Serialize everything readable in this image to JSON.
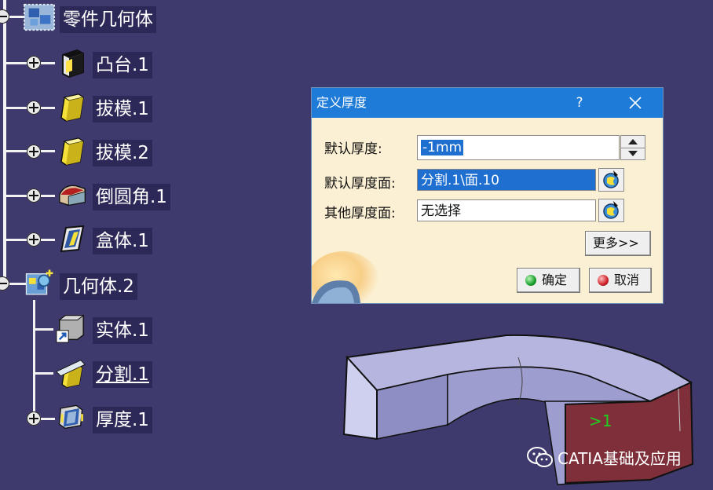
{
  "tree": {
    "root": {
      "label": "零件几何体",
      "icon": "part-body-icon"
    },
    "features": [
      {
        "label": "凸台.1",
        "icon": "pad-icon"
      },
      {
        "label": "拔模.1",
        "icon": "draft-icon"
      },
      {
        "label": "拔模.2",
        "icon": "draft-icon"
      },
      {
        "label": "倒圆角.1",
        "icon": "fillet-icon"
      },
      {
        "label": "盒体.1",
        "icon": "shell-icon"
      }
    ],
    "body2": {
      "label": "几何体.2",
      "icon": "geometric-body-icon",
      "children": [
        {
          "label": "实体.1",
          "icon": "solid-icon"
        },
        {
          "label": "分割.1",
          "icon": "split-icon"
        },
        {
          "label": "厚度.1",
          "icon": "thickness-icon"
        }
      ]
    }
  },
  "dialog": {
    "title": "定义厚度",
    "help": "?",
    "default_thickness_label": "默认厚度:",
    "default_thickness_value": "-1mm",
    "default_face_label": "默认厚度面:",
    "default_face_value": "分割.1\\面.10",
    "other_face_label": "其他厚度面:",
    "other_face_value": "无选择",
    "more_button": "更多>>",
    "ok_button": "确定",
    "cancel_button": "取消",
    "ok_led_color": "#19a02a",
    "cancel_led_color": "#d0202a"
  },
  "viewport": {
    "annotation": ">1"
  },
  "watermark": {
    "text": "CATIA基础及应用",
    "icon": "wechat-icon"
  }
}
